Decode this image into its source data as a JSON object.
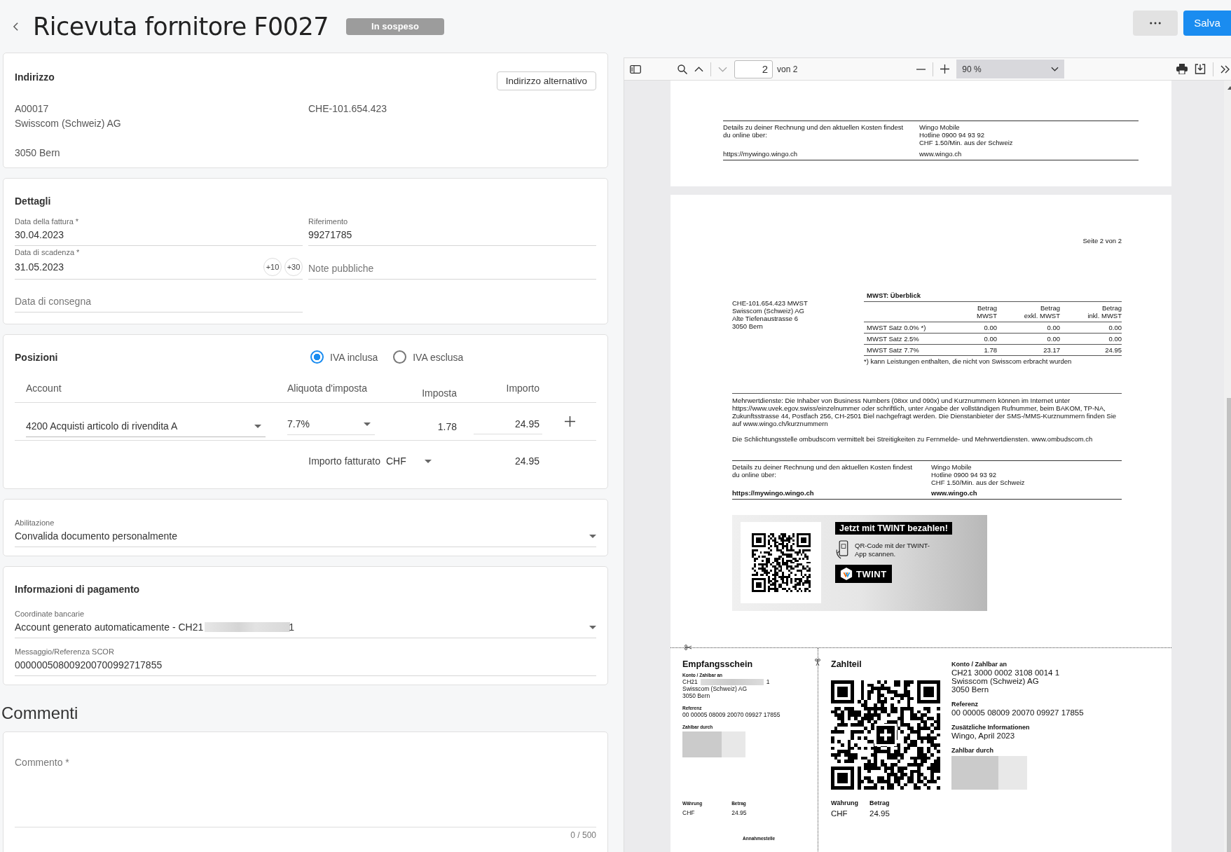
{
  "header": {
    "title": "Ricevuta fornitore F0027",
    "status": "In sospeso",
    "save": "Salva"
  },
  "address": {
    "heading": "Indirizzo",
    "alt_button": "Indirizzo alternativo",
    "lines": [
      "A00017",
      "Swisscom (Schweiz) AG"
    ],
    "city": "3050 Bern",
    "vat": "CHE-101.654.423"
  },
  "details": {
    "heading": "Dettagli",
    "fields": [
      {
        "label": "Data della fattura *",
        "value": "30.04.2023"
      },
      {
        "label": "Riferimento",
        "value": "99271785"
      },
      {
        "label": "Data di scadenza *",
        "value": "31.05.2023",
        "shortcuts": [
          "+10",
          "+30"
        ]
      },
      {
        "placeholder": "Note pubbliche"
      },
      {
        "placeholder": "Data di consegna"
      }
    ]
  },
  "positions": {
    "heading": "Posizioni",
    "vat_modes": [
      {
        "label": "IVA inclusa",
        "selected": true
      },
      {
        "label": "IVA esclusa",
        "selected": false
      }
    ],
    "columns": [
      "Account",
      "Aliquota d'imposta",
      "Imposta",
      "Importo"
    ],
    "rows": [
      {
        "account": "4200 Acquisti articolo di rivendita A",
        "rate": "7.7%",
        "tax": "1.78",
        "amount": "24.95"
      }
    ],
    "total_label": "Importo fatturato",
    "currency": "CHF",
    "total": "24.95"
  },
  "approval": {
    "label": "Abilitazione",
    "value": "Convalida documento personalmente"
  },
  "payment": {
    "heading": "Informazioni di pagamento",
    "bank_label": "Coordinate bancarie",
    "bank_prefix": "Account generato automaticamente - CH21",
    "bank_suffix": "1",
    "ref_label": "Messaggio/Referenza SCOR",
    "ref_value": "000000508009200700992717855"
  },
  "comments": {
    "heading": "Commenti",
    "placeholder": "Commento *",
    "counter": "0 / 500"
  },
  "viewer": {
    "page": "2",
    "page_total": "von 2",
    "zoom": "90 %",
    "page1_contact": {
      "intro": "Details zu deiner Rechnung und den aktuellen Kosten findest du online über:",
      "url": "https://mywingo.wingo.ch",
      "lines": [
        "Wingo Mobile",
        "Hotline 0900 94 93 92",
        "CHF 1.50/Min. aus der Schweiz"
      ],
      "site": "www.wingo.ch"
    },
    "page2": {
      "page_label": "Seite 2 von 2",
      "sender_lines": [
        "CHE-101.654.423 MWST",
        "Swisscom (Schweiz) AG",
        "Alte Tiefenaustrasse 6",
        "3050 Bern"
      ],
      "vat_table": {
        "title": "MWST: Überblick",
        "columns": [
          "",
          {
            "top": "Betrag",
            "bottom": "MWST"
          },
          {
            "top": "Betrag",
            "bottom": "exkl. MWST"
          },
          {
            "top": "Betrag",
            "bottom": "inkl. MWST"
          }
        ],
        "rows": [
          [
            "MWST Satz 0.0% *)",
            "0.00",
            "0.00",
            "0.00"
          ],
          [
            "MWST Satz 2.5%",
            "0.00",
            "0.00",
            "0.00"
          ],
          [
            "MWST Satz 7.7%",
            "1.78",
            "23.17",
            "24.95"
          ]
        ],
        "footnote": "*) kann Leistungen enthalten, die nicht von Swisscom erbracht wurden"
      },
      "notes": [
        "Mehrwertdienste: Die Inhaber von Business Numbers (08xx und 090x) und Kurznummern können im Internet unter https://www.uvek.egov.swiss/einzelnummer oder schriftlich, unter Angabe der vollständigen Rufnummer, beim BAKOM, TP-NA, Zukunftsstrasse 44, Postfach 256, CH-2501 Biel nachgefragt werden. Die Dienstanbieter der SMS-/MMS-Kurznummern finden Sie auf www.wingo.ch/kurznummern",
        "Die Schlichtungsstelle ombudscom vermittelt bei Streitigkeiten zu Fernmelde- und Mehrwertdiensten. www.ombudscom.ch"
      ],
      "contact": {
        "intro": "Details zu deiner Rechnung und den aktuellen Kosten findest du online über:",
        "url": "https://mywingo.wingo.ch",
        "lines": [
          "Wingo Mobile",
          "Hotline 0900 94 93 92",
          "CHF 1.50/Min. aus der Schweiz"
        ],
        "site": "www.wingo.ch"
      },
      "twint": {
        "banner": "Jetzt mit TWINT bezahlen!",
        "instruction": "QR-Code mit der TWINT-App scannen.",
        "logo": "TWINT"
      },
      "receipt": {
        "title": "Empfangsschein",
        "account_label": "Konto / Zahlbar an",
        "account_prefix": "CH21",
        "account_suffix": "1",
        "name": "Swisscom (Schweiz) AG",
        "city": "3050 Bern",
        "ref_label": "Referenz",
        "ref": "00 00005 08009 20070 09927 17855",
        "payer_label": "Zahlbar durch",
        "currency_label": "Währung",
        "currency": "CHF",
        "amount_label": "Betrag",
        "amount": "24.95",
        "acceptance": "Annahmestelle"
      },
      "payment_part": {
        "title": "Zahlteil",
        "account_label": "Konto / Zahlbar an",
        "account_lines": [
          "CH21 3000 0002 3108 0014 1",
          "Swisscom (Schweiz) AG",
          "3050 Bern"
        ],
        "ref_label": "Referenz",
        "ref": "00 00005 08009 20070 09927 17855",
        "info_label": "Zusätzliche Informationen",
        "info": "Wingo, April 2023",
        "payer_label": "Zahlbar durch",
        "currency_label": "Währung",
        "currency": "CHF",
        "amount_label": "Betrag",
        "amount": "24.95"
      }
    }
  }
}
